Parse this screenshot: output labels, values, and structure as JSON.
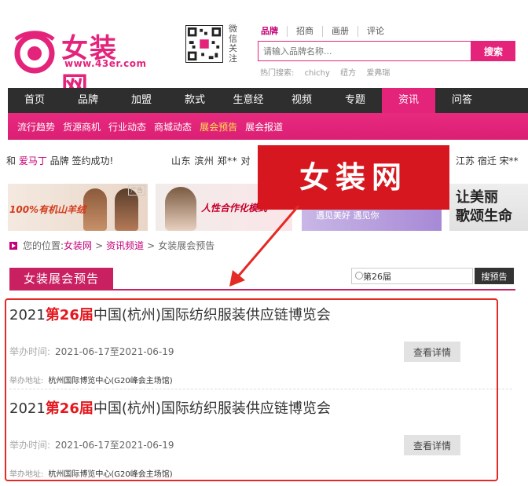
{
  "brand": {
    "name": "女装网",
    "url": "www.43er.com",
    "brand_color": "#e4237b"
  },
  "qr": {
    "label": "微信关注"
  },
  "search": {
    "tabs": [
      "品牌",
      "招商",
      "画册",
      "评论"
    ],
    "placeholder": "请输入品牌名称...",
    "button": "搜索",
    "hot_label": "热门搜索:",
    "hot_terms": [
      "chichy",
      "纽方",
      "爱弗瑞"
    ]
  },
  "nav": {
    "items": [
      "首页",
      "品牌",
      "加盟",
      "款式",
      "生意经",
      "视频",
      "专题",
      "资讯",
      "问答"
    ],
    "active_index": 7
  },
  "subnav": {
    "items": [
      "流行趋势",
      "货源商机",
      "行业动态",
      "商城动态",
      "展会预告",
      "展会报道"
    ],
    "active_index": 4
  },
  "ticker": {
    "part1_prefix": "和 ",
    "part1_brand": "爱马丁",
    "part1_suffix": " 品牌 签约成功!",
    "part2": "山东 滨州 郑** 对",
    "part3": "江苏 宿迁 宋**"
  },
  "ads": {
    "ad1_text": "100%有机山羊绒",
    "ad1_tag": "广告",
    "ad2_text": "人性合作化模式",
    "ad3_text": "遇见美好 遇见你",
    "ad4_line1": "让美丽",
    "ad4_line2": "歌颂生命"
  },
  "overlay": {
    "text": "女装网",
    "color": "#d6171f"
  },
  "breadcrumb": {
    "prefix": "您的位置:",
    "items": [
      "女装网",
      "资讯频道",
      "女装展会预告"
    ],
    "separator": ">"
  },
  "section": {
    "title": "女装展会预告",
    "search_value": "第26届",
    "search_button": "搜预告"
  },
  "list": {
    "items": [
      {
        "title_pre": "2021",
        "title_hl": "第26届",
        "title_post": "中国(杭州)国际纺织服装供应链博览会",
        "date_label": "举办时间:",
        "date_value": "2021-06-17至2021-06-19",
        "addr_label": "举办地址:",
        "addr_value": "杭州国际博览中心(G20峰会主场馆)",
        "button": "查看详情"
      },
      {
        "title_pre": "2021",
        "title_hl": "第26届",
        "title_post": "中国(杭州)国际纺织服装供应链博览会",
        "date_label": "举办时间:",
        "date_value": "2021-06-17至2021-06-19",
        "addr_label": "举办地址:",
        "addr_value": "杭州国际博览中心(G20峰会主场馆)",
        "button": "查看详情"
      }
    ],
    "highlight_color": "#e32a24"
  }
}
